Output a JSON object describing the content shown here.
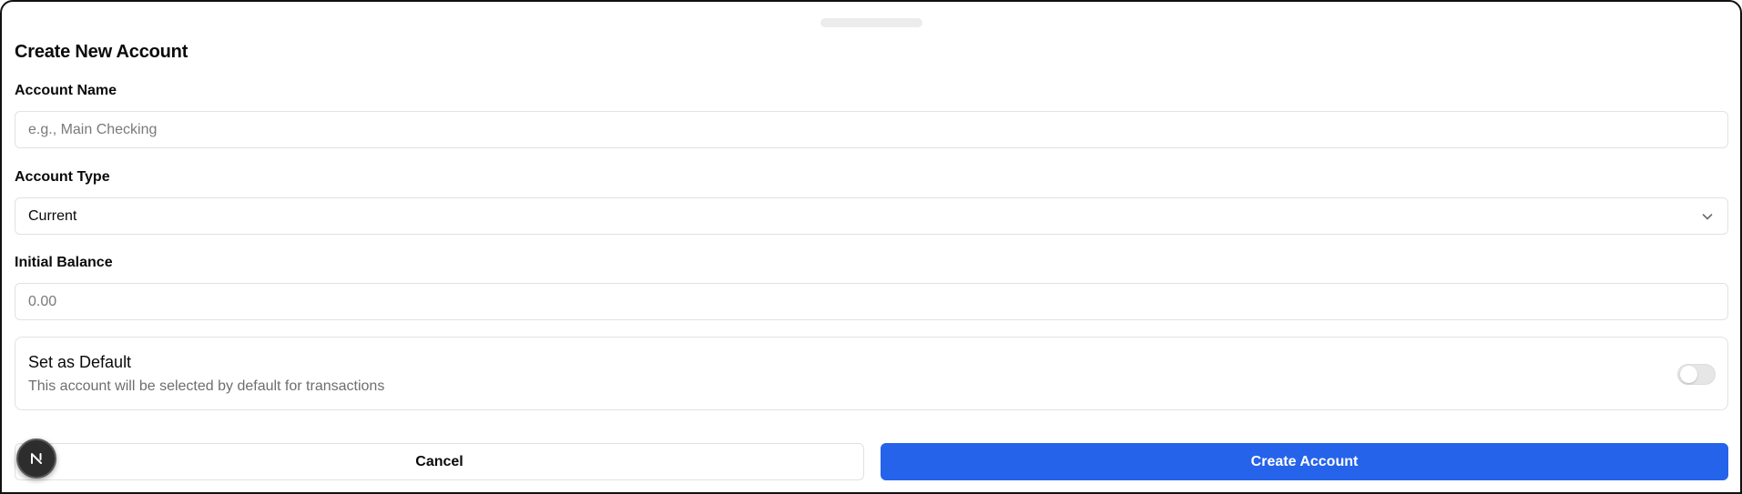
{
  "dialog": {
    "title": "Create New Account"
  },
  "form": {
    "account_name": {
      "label": "Account Name",
      "value": "",
      "placeholder": "e.g., Main Checking"
    },
    "account_type": {
      "label": "Account Type",
      "selected": "Current"
    },
    "initial_balance": {
      "label": "Initial Balance",
      "value": "",
      "placeholder": "0.00"
    },
    "set_default": {
      "title": "Set as Default",
      "description": "This account will be selected by default for transactions",
      "checked": false
    }
  },
  "actions": {
    "cancel_label": "Cancel",
    "create_label": "Create Account"
  },
  "icons": {
    "select": "chevron-down-icon",
    "dev_badge": "nextjs-logo-icon"
  },
  "colors": {
    "primary": "#2563eb",
    "border": "#e2e2e2",
    "muted_text": "#6e6e6e"
  }
}
